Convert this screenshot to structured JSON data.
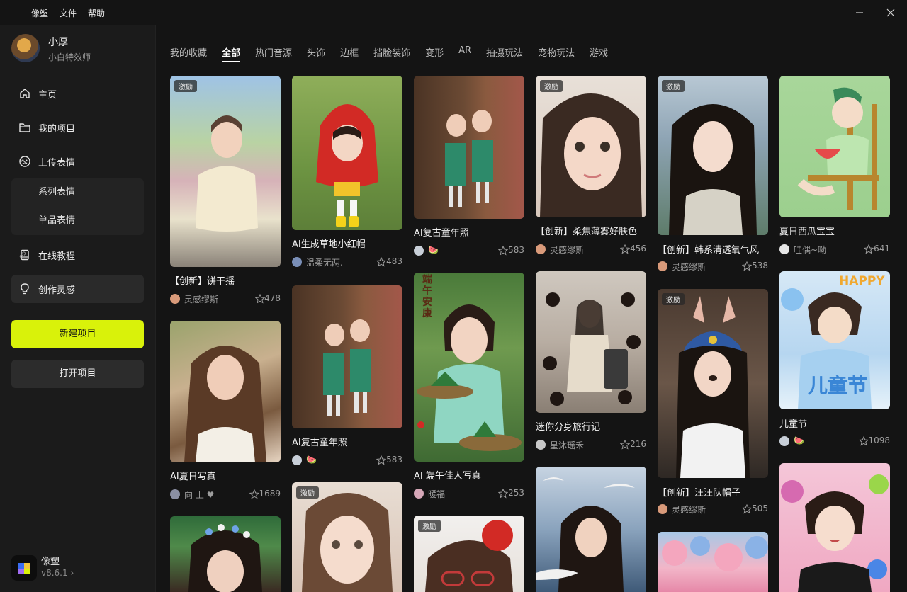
{
  "menu": [
    "像塑",
    "文件",
    "帮助"
  ],
  "user": {
    "name": "小厚",
    "role": "小白特效师"
  },
  "nav": {
    "home": "主页",
    "projects": "我的项目",
    "upload": "上传表情",
    "series": "系列表情",
    "single": "单品表情",
    "tutorial": "在线教程",
    "inspiration": "创作灵感"
  },
  "buttons": {
    "new_project": "新建项目",
    "open_project": "打开项目"
  },
  "app": {
    "name": "像塑",
    "version": "v8.6.1"
  },
  "tabs": [
    "我的收藏",
    "全部",
    "热门音源",
    "头饰",
    "边框",
    "挡脸装饰",
    "变形",
    "AR",
    "拍摄玩法",
    "宠物玩法",
    "游戏"
  ],
  "active_tab": "全部",
  "badge_label": "激励",
  "cards": [
    {
      "title": "【创新】饼干摇",
      "author": "灵感缪斯",
      "likes": "478"
    },
    {
      "title": "AI夏日写真",
      "author": "向 上 ♥",
      "likes": "1689"
    },
    {
      "title": "",
      "author": "",
      "likes": ""
    },
    {
      "title": "AI生成草地小红帽",
      "author": "温柔无两.",
      "likes": "483"
    },
    {
      "title": "AI复古童年照",
      "author": "",
      "likes": "583"
    },
    {
      "title": "",
      "author": "",
      "likes": ""
    },
    {
      "title": "AI复古童年照",
      "author": "",
      "likes": "583"
    },
    {
      "title": "AI 端午佳人写真",
      "author": "暖福",
      "likes": "253"
    },
    {
      "title": "",
      "author": "",
      "likes": ""
    },
    {
      "title": "【创新】柔焦薄雾好肤色",
      "author": "灵感缪斯",
      "likes": "456"
    },
    {
      "title": "迷你分身旅行记",
      "author": "星沐瑶禾",
      "likes": "216"
    },
    {
      "title": "",
      "author": "",
      "likes": ""
    },
    {
      "title": "【创新】韩系清透氧气风",
      "author": "灵感缪斯",
      "likes": "538"
    },
    {
      "title": "【创新】汪汪队帽子",
      "author": "灵感缪斯",
      "likes": "505"
    },
    {
      "title": "",
      "author": "",
      "likes": ""
    },
    {
      "title": "夏日西瓜宝宝",
      "author": "哇偶~呦",
      "likes": "641"
    },
    {
      "title": "儿童节",
      "author": "",
      "likes": "1098"
    },
    {
      "title": "",
      "author": "",
      "likes": ""
    }
  ],
  "thumb_texts": {
    "duanwu": "端午安康",
    "happy": "HAPPY",
    "childday": "儿童节"
  }
}
